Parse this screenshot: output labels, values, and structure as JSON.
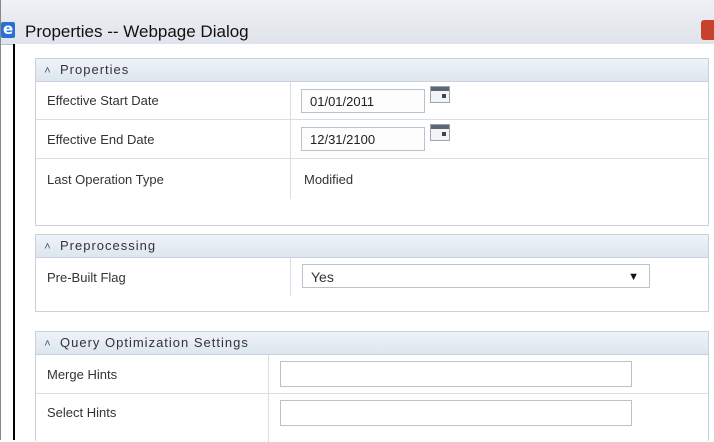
{
  "window": {
    "title": "Properties -- Webpage Dialog"
  },
  "properties": {
    "header": "Properties",
    "effective_start_date": {
      "label": "Effective Start Date",
      "value": "01/01/2011"
    },
    "effective_end_date": {
      "label": "Effective End Date",
      "value": "12/31/2100"
    },
    "last_operation_type": {
      "label": "Last Operation Type",
      "value": "Modified"
    }
  },
  "preprocessing": {
    "header": "Preprocessing",
    "pre_built_flag": {
      "label": "Pre-Built Flag",
      "value": "Yes"
    }
  },
  "query_optimization": {
    "header": "Query Optimization Settings",
    "merge_hints": {
      "label": "Merge Hints",
      "value": ""
    },
    "select_hints": {
      "label": "Select Hints",
      "value": ""
    }
  },
  "icons": {
    "collapse": "double-chevron-up-icon",
    "calendar": "calendar-icon",
    "dropdown": "chevron-down-icon"
  }
}
